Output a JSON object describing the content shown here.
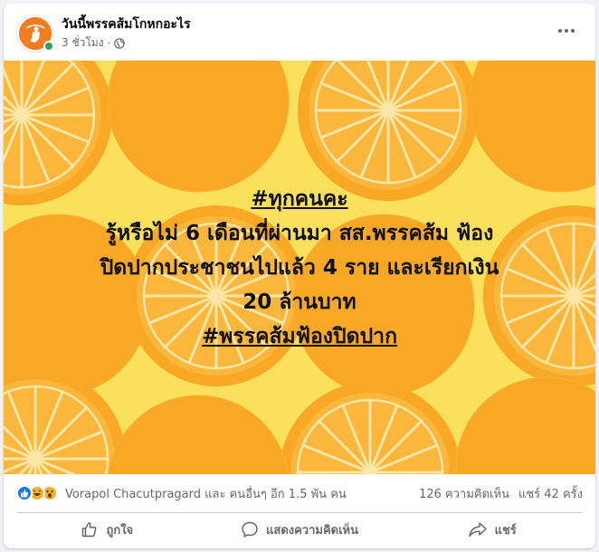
{
  "post": {
    "page_name": "วันนี้พรรคส้มโกหกอะไร",
    "time": "3 ชั่วโมง",
    "separator": "·",
    "privacy_icon": "globe-icon",
    "menu_icon": "more-icon",
    "avatar_icon": "page-avatar"
  },
  "image": {
    "hashtag_top": "#ทุกคนคะ",
    "line1": "รู้หรือไม่ 6 เดือนที่ผ่านมา สส.พรรคส้ม ฟ้อง",
    "line2": "ปิดปากประชาชนไปแล้ว 4 ราย และเรียกเงิน",
    "line3": "20 ล้านบาท",
    "hashtag_bottom": "#พรรคส้มฟ้องปิดปาก",
    "colors": {
      "background": "#fbe05c",
      "orange": "#f9a825",
      "orange_light": "#fbb63c"
    }
  },
  "engagement": {
    "reactions": [
      "like-icon",
      "haha-icon",
      "wow-icon"
    ],
    "summary": "Vorapol Chacutpragard และ คนอื่นๆ อีก 1.5 พัน คน",
    "comments": "126 ความคิดเห็น",
    "shares": "แชร์ 42 ครั้ง"
  },
  "actions": {
    "like": "ถูกใจ",
    "comment": "แสดงความคิดเห็น",
    "share": "แชร์"
  },
  "colors": {
    "secondary_text": "#65676b",
    "like_blue": "#1877f2",
    "online_green": "#31a24c",
    "avatar_orange": "#f47c20"
  }
}
